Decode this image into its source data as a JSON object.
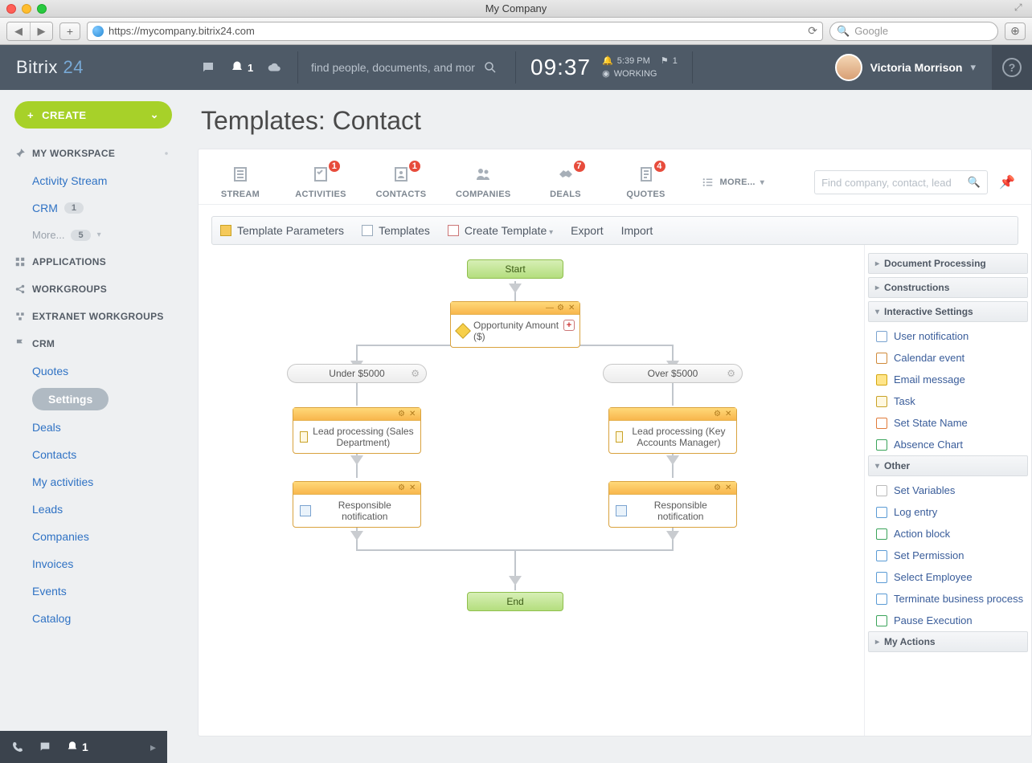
{
  "browser": {
    "window_title": "My Company",
    "url": "https://mycompany.bitrix24.com",
    "search_placeholder": "Google"
  },
  "header": {
    "brand_a": "Bitrix",
    "brand_b": "24",
    "notif_count": "1",
    "search_placeholder": "find people, documents, and mor",
    "clock": "09:37",
    "time_small": "5:39 PM",
    "flag_count": "1",
    "status": "WORKING",
    "user": "Victoria Morrison"
  },
  "sidebar": {
    "create": "CREATE",
    "workspace_head": "MY WORKSPACE",
    "ws_items": {
      "activity": "Activity Stream",
      "crm": "CRM",
      "crm_badge": "1",
      "more": "More...",
      "more_badge": "5"
    },
    "applications": "APPLICATIONS",
    "workgroups": "WORKGROUPS",
    "extranet": "EXTRANET WORKGROUPS",
    "crm_head": "CRM",
    "crm_items": [
      "Quotes",
      "Settings",
      "Deals",
      "Contacts",
      "My activities",
      "Leads",
      "Companies",
      "Invoices",
      "Events",
      "Catalog"
    ],
    "bottom_notif": "1"
  },
  "page": {
    "title": "Templates: Contact"
  },
  "tabs": {
    "stream": "STREAM",
    "activities": "ACTIVITIES",
    "activities_n": "1",
    "contacts": "CONTACTS",
    "contacts_n": "1",
    "companies": "COMPANIES",
    "deals": "DEALS",
    "deals_n": "7",
    "quotes": "QUOTES",
    "quotes_n": "4",
    "more": "MORE...",
    "find_placeholder": "Find company, contact, lead"
  },
  "toolbar2": {
    "params": "Template Parameters",
    "templates": "Templates",
    "create": "Create Template",
    "export": "Export",
    "import": "Import"
  },
  "flow": {
    "start": "Start",
    "cond": "Opportunity Amount ($)",
    "under": "Under $5000",
    "over": "Over $5000",
    "lead_left": "Lead processing (Sales Department)",
    "lead_right": "Lead processing (Key Accounts Manager)",
    "notif": "Responsible notification",
    "end": "End"
  },
  "palette": {
    "doc": "Document Processing",
    "cons": "Constructions",
    "inter": "Interactive Settings",
    "inter_items": [
      "User notification",
      "Calendar event",
      "Email message",
      "Task",
      "Set State Name",
      "Absence Chart"
    ],
    "other": "Other",
    "other_items": [
      "Set Variables",
      "Log entry",
      "Action block",
      "Set Permission",
      "Select Employee",
      "Terminate business process",
      "Pause Execution"
    ],
    "myactions": "My Actions"
  }
}
